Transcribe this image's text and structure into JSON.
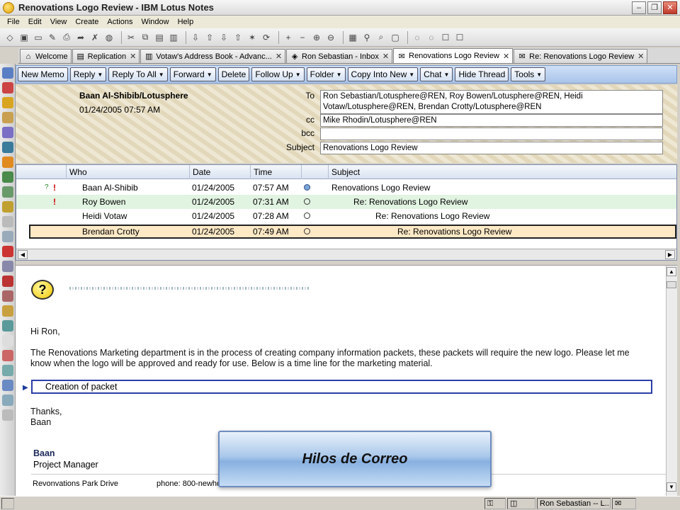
{
  "window": {
    "title": "Renovations Logo Review - IBM Lotus Notes"
  },
  "menu": [
    "File",
    "Edit",
    "View",
    "Create",
    "Actions",
    "Window",
    "Help"
  ],
  "tabs": [
    {
      "label": "Welcome",
      "icon": "home-icon",
      "closable": false,
      "active": false
    },
    {
      "label": "Replication",
      "icon": "replication-icon",
      "closable": true,
      "active": false
    },
    {
      "label": "Votaw's Address Book - Advanc...",
      "icon": "address-book-icon",
      "closable": true,
      "active": false
    },
    {
      "label": "Ron Sebastian - Inbox",
      "icon": "inbox-icon",
      "closable": true,
      "active": false
    },
    {
      "label": "Renovations Logo Review",
      "icon": "memo-icon",
      "closable": true,
      "active": true
    },
    {
      "label": "Re: Renovations Logo Review",
      "icon": "memo-icon",
      "closable": true,
      "active": false
    }
  ],
  "actions": [
    {
      "label": "New Memo",
      "dropdown": false
    },
    {
      "label": "Reply",
      "dropdown": true
    },
    {
      "label": "Reply To All",
      "dropdown": true
    },
    {
      "label": "Forward",
      "dropdown": true
    },
    {
      "label": "Delete",
      "dropdown": false
    },
    {
      "label": "Follow Up",
      "dropdown": true
    },
    {
      "label": "Folder",
      "dropdown": true
    },
    {
      "label": "Copy Into New",
      "dropdown": true
    },
    {
      "label": "Chat",
      "dropdown": true
    },
    {
      "label": "Hide Thread",
      "dropdown": false
    },
    {
      "label": "Tools",
      "dropdown": true
    }
  ],
  "header": {
    "from": "Baan Al-Shibib/Lotusphere",
    "date": "01/24/2005 07:57 AM",
    "to_label": "To",
    "to_value": "Ron Sebastian/Lotusphere@REN, Roy Bowen/Lotusphere@REN, Heidi Votaw/Lotusphere@REN, Brendan Crotty/Lotusphere@REN",
    "cc_label": "cc",
    "cc_value": "Mike Rhodin/Lotusphere@REN",
    "bcc_label": "bcc",
    "bcc_value": "",
    "subject_label": "Subject",
    "subject_value": "Renovations Logo Review"
  },
  "thread": {
    "columns": {
      "who": "Who",
      "date": "Date",
      "time": "Time",
      "subject": "Subject"
    },
    "rows": [
      {
        "who": "Baan Al-Shibib",
        "date": "01/24/2005",
        "time": "07:57 AM",
        "subject": "Renovations Logo Review",
        "flags": "?!",
        "state": "normal",
        "level": 0,
        "read": true
      },
      {
        "who": "Roy Bowen",
        "date": "01/24/2005",
        "time": "07:31 AM",
        "subject": "Re: Renovations Logo Review",
        "flags": "!",
        "state": "alt",
        "level": 1,
        "read": false
      },
      {
        "who": "Heidi Votaw",
        "date": "01/24/2005",
        "time": "07:28 AM",
        "subject": "Re: Renovations Logo Review",
        "flags": "",
        "state": "normal",
        "level": 2,
        "read": false
      },
      {
        "who": "Brendan Crotty",
        "date": "01/24/2005",
        "time": "07:49 AM",
        "subject": "Re: Renovations Logo Review",
        "flags": "",
        "state": "selected",
        "level": 3,
        "read": false
      }
    ]
  },
  "body": {
    "greeting": "Hi Ron,",
    "paragraph_line1": "The Renovations Marketing department is in the process of creating company information packets, these packets will require the new logo.  Please let me",
    "paragraph_line2": "know when the logo will be approved and ready for use.  Below is a time line for the marketing material.",
    "section_title": "Creation of packet",
    "closing": "Thanks,",
    "closing_name": "Baan",
    "sig_name": "Baan",
    "sig_title": "Project Manager",
    "sig_address": "Revonvations Park Drive",
    "sig_phone": "phone: 800-newhome"
  },
  "overlay": {
    "label": "Hilos de Correo"
  },
  "status": {
    "user": "Ron Sebastian -- L..."
  }
}
